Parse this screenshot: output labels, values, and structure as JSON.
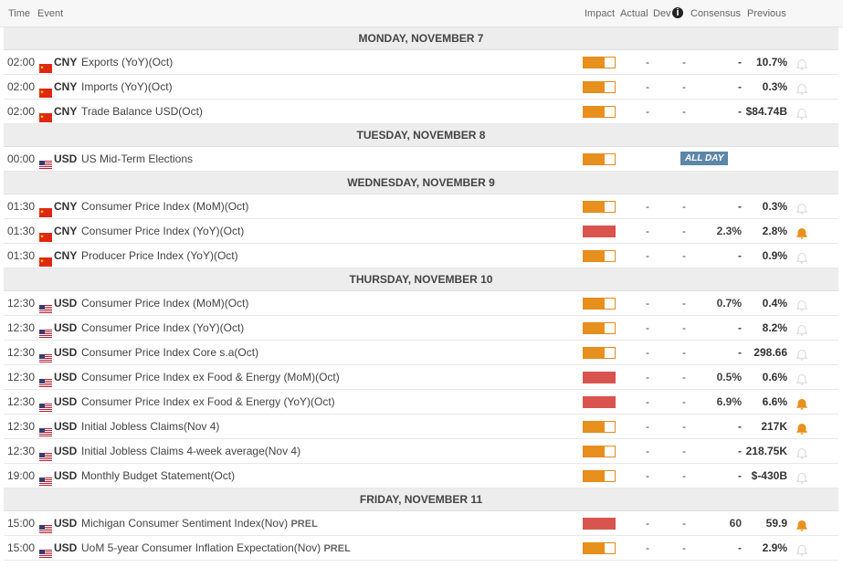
{
  "header": {
    "time": "Time",
    "event": "Event",
    "impact": "Impact",
    "actual": "Actual",
    "dev": "Dev",
    "consensus": "Consensus",
    "previous": "Previous"
  },
  "colors": {
    "medium_impact": "#e8901e",
    "high_impact": "#d9544f",
    "bell_active": "#e8901e",
    "all_day_badge": "#5c87a9"
  },
  "days": [
    {
      "label": "MONDAY, NOVEMBER 7",
      "events": [
        {
          "time": "02:00",
          "flag": "cn-flag-icon",
          "currency": "CNY",
          "event": "Exports (YoY)(Oct)",
          "prel": "",
          "impact": "medium",
          "impact_level": 0.67,
          "actual": "-",
          "dev": "-",
          "consensus": "-",
          "previous": "10.7%",
          "alert": false
        },
        {
          "time": "02:00",
          "flag": "cn-flag-icon",
          "currency": "CNY",
          "event": "Imports (YoY)(Oct)",
          "prel": "",
          "impact": "medium",
          "impact_level": 0.67,
          "actual": "-",
          "dev": "-",
          "consensus": "-",
          "previous": "0.3%",
          "alert": false
        },
        {
          "time": "02:00",
          "flag": "cn-flag-icon",
          "currency": "CNY",
          "event": "Trade Balance USD(Oct)",
          "prel": "",
          "impact": "medium",
          "impact_level": 0.67,
          "actual": "-",
          "dev": "-",
          "consensus": "-",
          "previous": "$84.74B",
          "alert": false
        }
      ]
    },
    {
      "label": "TUESDAY, NOVEMBER 8",
      "events": [
        {
          "time": "00:00",
          "flag": "us-flag-icon",
          "currency": "USD",
          "event": "US Mid-Term Elections",
          "prel": "",
          "impact": "medium",
          "impact_level": 0.67,
          "all_day": "ALL DAY",
          "alert": null
        }
      ]
    },
    {
      "label": "WEDNESDAY, NOVEMBER 9",
      "events": [
        {
          "time": "01:30",
          "flag": "cn-flag-icon",
          "currency": "CNY",
          "event": "Consumer Price Index (MoM)(Oct)",
          "prel": "",
          "impact": "medium",
          "impact_level": 0.67,
          "actual": "-",
          "dev": "-",
          "consensus": "-",
          "previous": "0.3%",
          "alert": false
        },
        {
          "time": "01:30",
          "flag": "cn-flag-icon",
          "currency": "CNY",
          "event": "Consumer Price Index (YoY)(Oct)",
          "prel": "",
          "impact": "high",
          "impact_level": 1.0,
          "actual": "-",
          "dev": "-",
          "consensus": "2.3%",
          "previous": "2.8%",
          "alert": true
        },
        {
          "time": "01:30",
          "flag": "cn-flag-icon",
          "currency": "CNY",
          "event": "Producer Price Index (YoY)(Oct)",
          "prel": "",
          "impact": "medium",
          "impact_level": 0.67,
          "actual": "-",
          "dev": "-",
          "consensus": "-",
          "previous": "0.9%",
          "alert": false
        }
      ]
    },
    {
      "label": "THURSDAY, NOVEMBER 10",
      "events": [
        {
          "time": "12:30",
          "flag": "us-flag-icon",
          "currency": "USD",
          "event": "Consumer Price Index (MoM)(Oct)",
          "prel": "",
          "impact": "medium",
          "impact_level": 0.67,
          "actual": "-",
          "dev": "-",
          "consensus": "0.7%",
          "previous": "0.4%",
          "alert": false
        },
        {
          "time": "12:30",
          "flag": "us-flag-icon",
          "currency": "USD",
          "event": "Consumer Price Index (YoY)(Oct)",
          "prel": "",
          "impact": "medium",
          "impact_level": 0.67,
          "actual": "-",
          "dev": "-",
          "consensus": "-",
          "previous": "8.2%",
          "alert": false
        },
        {
          "time": "12:30",
          "flag": "us-flag-icon",
          "currency": "USD",
          "event": "Consumer Price Index Core s.a(Oct)",
          "prel": "",
          "impact": "medium",
          "impact_level": 0.67,
          "actual": "-",
          "dev": "-",
          "consensus": "-",
          "previous": "298.66",
          "alert": false
        },
        {
          "time": "12:30",
          "flag": "us-flag-icon",
          "currency": "USD",
          "event": "Consumer Price Index ex Food & Energy (MoM)(Oct)",
          "prel": "",
          "impact": "high",
          "impact_level": 1.0,
          "actual": "-",
          "dev": "-",
          "consensus": "0.5%",
          "previous": "0.6%",
          "alert": false
        },
        {
          "time": "12:30",
          "flag": "us-flag-icon",
          "currency": "USD",
          "event": "Consumer Price Index ex Food & Energy (YoY)(Oct)",
          "prel": "",
          "impact": "high",
          "impact_level": 1.0,
          "actual": "-",
          "dev": "-",
          "consensus": "6.9%",
          "previous": "6.6%",
          "alert": true
        },
        {
          "time": "12:30",
          "flag": "us-flag-icon",
          "currency": "USD",
          "event": "Initial Jobless Claims(Nov 4)",
          "prel": "",
          "impact": "medium",
          "impact_level": 0.67,
          "actual": "-",
          "dev": "-",
          "consensus": "-",
          "previous": "217K",
          "alert": true
        },
        {
          "time": "12:30",
          "flag": "us-flag-icon",
          "currency": "USD",
          "event": "Initial Jobless Claims 4-week average(Nov 4)",
          "prel": "",
          "impact": "medium",
          "impact_level": 0.67,
          "actual": "-",
          "dev": "-",
          "consensus": "-",
          "previous": "218.75K",
          "alert": false
        },
        {
          "time": "19:00",
          "flag": "us-flag-icon",
          "currency": "USD",
          "event": "Monthly Budget Statement(Oct)",
          "prel": "",
          "impact": "medium",
          "impact_level": 0.67,
          "actual": "-",
          "dev": "-",
          "consensus": "-",
          "previous": "$-430B",
          "alert": false
        }
      ]
    },
    {
      "label": "FRIDAY, NOVEMBER 11",
      "events": [
        {
          "time": "15:00",
          "flag": "us-flag-icon",
          "currency": "USD",
          "event": "Michigan Consumer Sentiment Index(Nov)",
          "prel": "PREL",
          "impact": "high",
          "impact_level": 1.0,
          "actual": "-",
          "dev": "-",
          "consensus": "60",
          "previous": "59.9",
          "alert": true
        },
        {
          "time": "15:00",
          "flag": "us-flag-icon",
          "currency": "USD",
          "event": "UoM 5-year Consumer Inflation Expectation(Nov)",
          "prel": "PREL",
          "impact": "medium",
          "impact_level": 0.67,
          "actual": "-",
          "dev": "-",
          "consensus": "-",
          "previous": "2.9%",
          "alert": false
        }
      ]
    }
  ]
}
